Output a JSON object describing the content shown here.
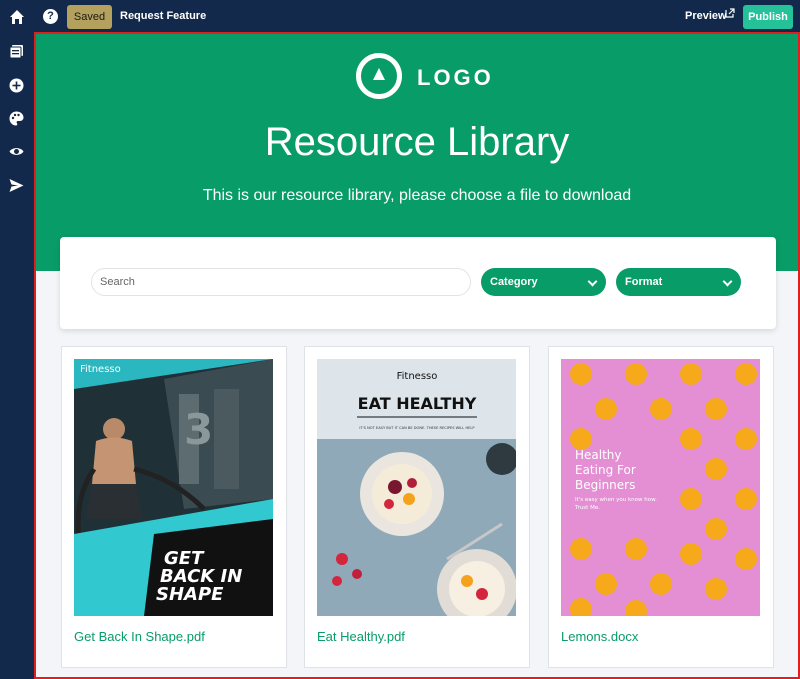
{
  "topbar": {
    "saved_label": "Saved",
    "request_feature": "Request Feature",
    "preview_label": "Preview",
    "publish_label": "Publish",
    "help_glyph": "?"
  },
  "sidebar": {
    "icons": [
      "pages-icon",
      "add-icon",
      "palette-icon",
      "eye-icon",
      "send-icon"
    ]
  },
  "hero": {
    "logo_text": "LOGO",
    "title": "Resource Library",
    "subtitle": "This is our resource library, please choose a file to download",
    "bg_color": "#089c68"
  },
  "filters": {
    "search_placeholder": "Search",
    "category_label": "Category",
    "format_label": "Format"
  },
  "files": [
    {
      "name": "Get Back In Shape.pdf",
      "brand": "Fitnesso",
      "cover_title": "GET BACK IN SHAPE"
    },
    {
      "name": "Eat Healthy.pdf",
      "brand": "Fitnesso",
      "cover_title": "EAT HEALTHY",
      "cover_sub": "IT'S NOT EASY BUT IT CAN BE DONE. THESE RECIPES WILL HELP"
    },
    {
      "name": "Lemons.docx",
      "cover_title": "Healthy Eating For Beginners",
      "cover_sub": "It's easy when you know how. Trust Me."
    }
  ],
  "colors": {
    "topbar": "#13294b",
    "accent": "#089c68",
    "publish": "#25c29a",
    "saved": "#b3a15d",
    "selection_border": "#e02020"
  }
}
